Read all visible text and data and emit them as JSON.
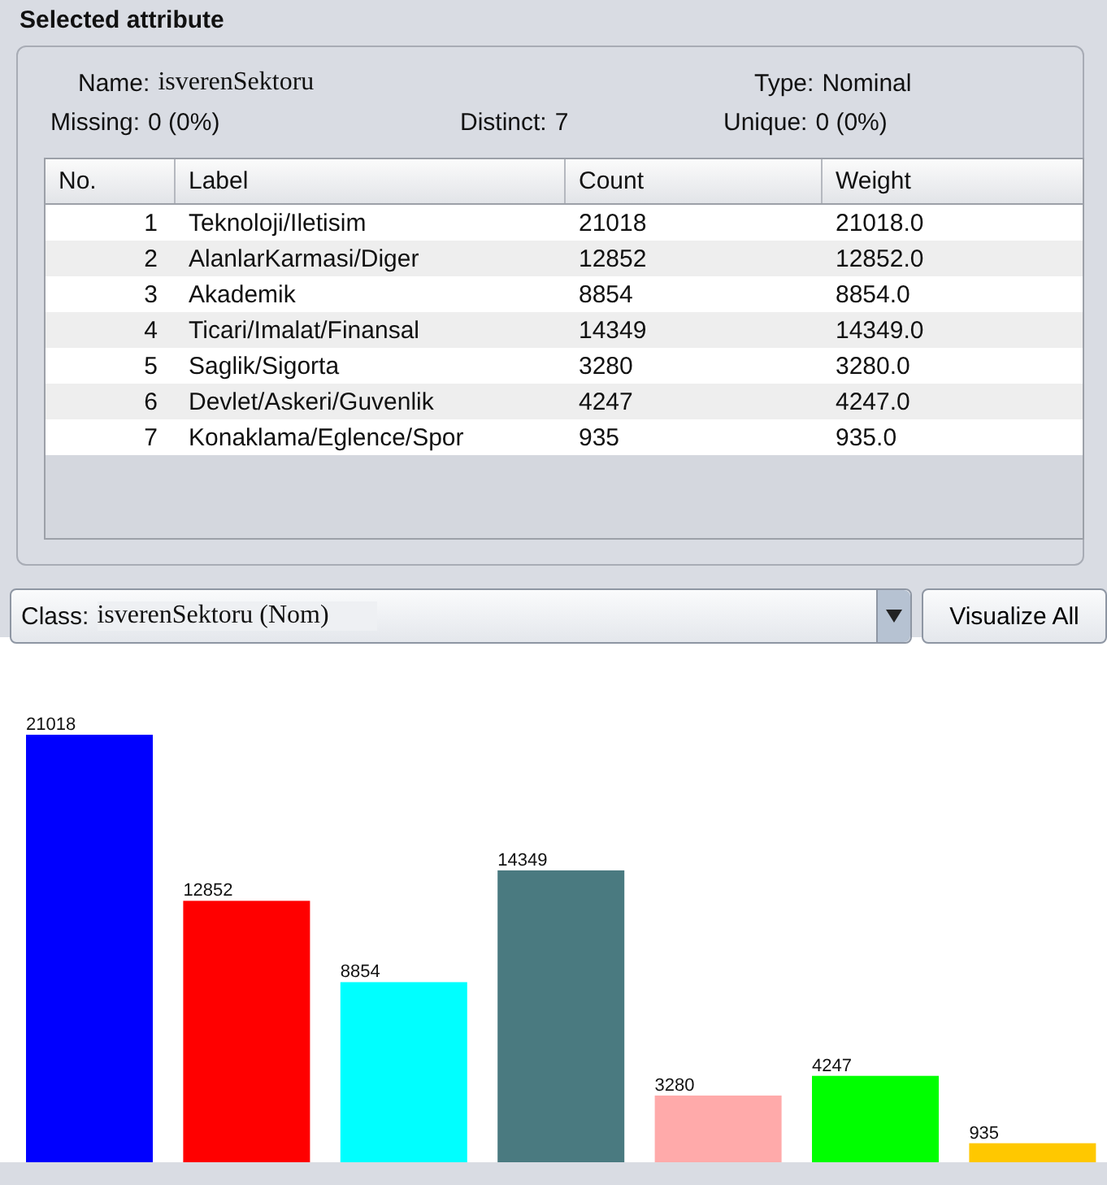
{
  "panel_title": "Selected attribute",
  "info": {
    "name_label": "Name:",
    "name": "isverenSektoru",
    "type_label": "Type:",
    "type": "Nominal",
    "missing_label": "Missing:",
    "missing": "0 (0%)",
    "distinct_label": "Distinct:",
    "distinct": "7",
    "unique_label": "Unique:",
    "unique": "0 (0%)"
  },
  "table": {
    "columns": [
      "No.",
      "Label",
      "Count",
      "Weight"
    ],
    "rows": [
      [
        "1",
        "Teknoloji/Iletisim",
        "21018",
        "21018.0"
      ],
      [
        "2",
        "AlanlarKarmasi/Diger",
        "12852",
        "12852.0"
      ],
      [
        "3",
        "Akademik",
        "8854",
        "8854.0"
      ],
      [
        "4",
        "Ticari/Imalat/Finansal",
        "14349",
        "14349.0"
      ],
      [
        "5",
        "Saglik/Sigorta",
        "3280",
        "3280.0"
      ],
      [
        "6",
        "Devlet/Askeri/Guvenlik",
        "4247",
        "4247.0"
      ],
      [
        "7",
        "Konaklama/Eglence/Spor",
        "935",
        "935.0"
      ]
    ]
  },
  "class_select": {
    "label": "Class:",
    "value": "isverenSektoru (Nom)"
  },
  "visualize_button": "Visualize All",
  "chart_data": {
    "type": "bar",
    "values": [
      21018,
      12852,
      8854,
      14349,
      3280,
      4247,
      935
    ],
    "data_labels": true,
    "colors": [
      "#0000ff",
      "#ff0000",
      "#00ffff",
      "#4a7a80",
      "#ffaaaa",
      "#00ff00",
      "#ffc800"
    ]
  }
}
